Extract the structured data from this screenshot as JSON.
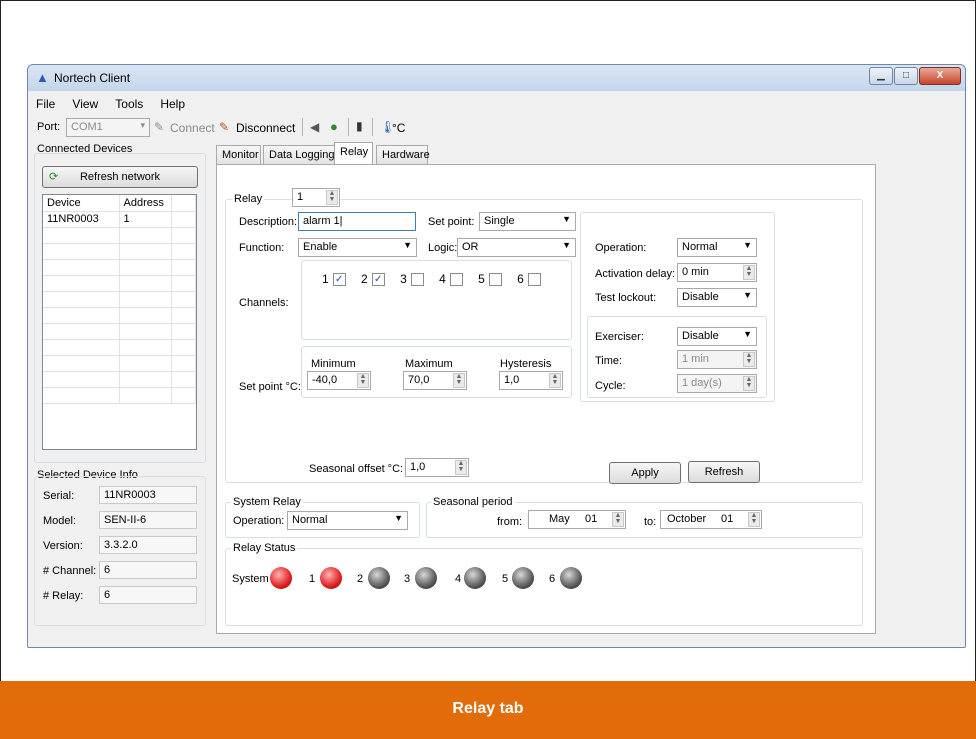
{
  "window": {
    "title": "Nortech Client",
    "min": "▁",
    "max": "□",
    "close": "X"
  },
  "menu": [
    "File",
    "View",
    "Tools",
    "Help"
  ],
  "toolbar": {
    "port_label": "Port:",
    "port_value": "COM1",
    "connect": "Connect",
    "disconnect": "Disconnect",
    "temp_unit": "°C"
  },
  "left": {
    "connected_title": "Connected Devices",
    "refresh_network": "Refresh network",
    "table_headers": [
      "Device",
      "Address"
    ],
    "rows": [
      {
        "device": "11NR0003",
        "address": "1"
      }
    ],
    "selected_title": "Selected Device Info",
    "info": [
      {
        "label": "Serial:",
        "value": "11NR0003"
      },
      {
        "label": "Model:",
        "value": "SEN-II-6"
      },
      {
        "label": "Version:",
        "value": "3.3.2.0"
      },
      {
        "label": "# Channel:",
        "value": "6"
      },
      {
        "label": "# Relay:",
        "value": "6"
      }
    ]
  },
  "tabs": [
    "Monitor",
    "Data Logging",
    "Relay",
    "Hardware"
  ],
  "relay": {
    "relay_label": "Relay",
    "relay_value": "1",
    "description_label": "Description:",
    "description_value": "alarm 1|",
    "set_point_label": "Set point:",
    "set_point_value": "Single",
    "function_label": "Function:",
    "function_value": "Enable",
    "logic_label": "Logic:",
    "logic_value": "OR",
    "channels_label": "Channels:",
    "channels": [
      {
        "n": "1",
        "checked": true
      },
      {
        "n": "2",
        "checked": true
      },
      {
        "n": "3",
        "checked": false
      },
      {
        "n": "4",
        "checked": false
      },
      {
        "n": "5",
        "checked": false
      },
      {
        "n": "6",
        "checked": false
      }
    ],
    "operation_label": "Operation:",
    "operation_value": "Normal",
    "activation_label": "Activation delay:",
    "activation_value": "0 min",
    "lockout_label": "Test lockout:",
    "lockout_value": "Disable",
    "exerciser_label": "Exerciser:",
    "exerciser_value": "Disable",
    "time_label": "Time:",
    "time_value": "1 min",
    "cycle_label": "Cycle:",
    "cycle_value": "1 day(s)",
    "setpoint_c_label": "Set point °C:",
    "min_label": "Minimum",
    "min_value": "-40,0",
    "max_label": "Maximum",
    "max_value": "70,0",
    "hyst_label": "Hysteresis",
    "hyst_value": "1,0",
    "seasonal_offset_label": "Seasonal offset °C:",
    "seasonal_offset_value": "1,0",
    "apply": "Apply",
    "refresh": "Refresh"
  },
  "system_relay": {
    "title": "System Relay",
    "operation_label": "Operation:",
    "operation_value": "Normal"
  },
  "seasonal": {
    "title": "Seasonal period",
    "from_label": "from:",
    "from_month": "May",
    "from_day": "01",
    "to_label": "to:",
    "to_month": "October",
    "to_day": "01"
  },
  "status": {
    "title": "Relay Status",
    "system_label": "System",
    "leds": [
      "1",
      "2",
      "3",
      "4",
      "5",
      "6"
    ]
  },
  "caption": "Relay tab"
}
